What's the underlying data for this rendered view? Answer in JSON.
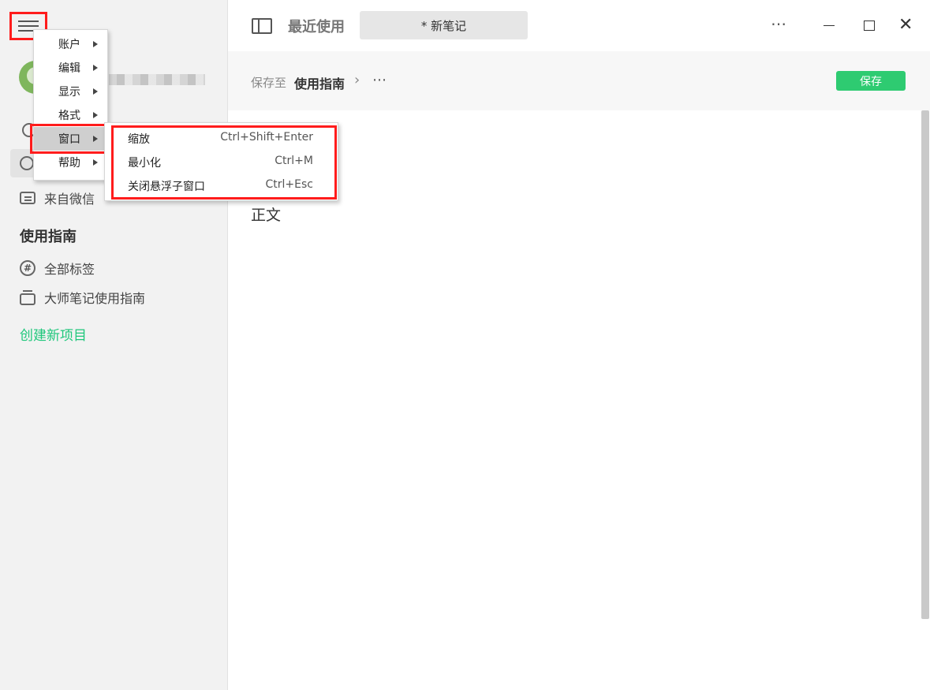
{
  "sidebar": {
    "recent_label": "最近使用",
    "wechat_label": "来自微信",
    "section_title": "使用指南",
    "all_tags_label": "全部标签",
    "guide_notebook_label": "大师笔记使用指南",
    "create_project_label": "创建新项目"
  },
  "topbar": {
    "title": "最近使用",
    "note_tab": "* 新笔记",
    "more_icon": "⋯",
    "close_icon": "✕"
  },
  "breadcrumb": {
    "save_to": "保存至",
    "target": "使用指南",
    "chevron": "›",
    "more": "⋯",
    "save_button": "保存"
  },
  "editor": {
    "body_text": "正文"
  },
  "menu": {
    "items": [
      {
        "label": "账户"
      },
      {
        "label": "编辑"
      },
      {
        "label": "显示"
      },
      {
        "label": "格式"
      },
      {
        "label": "窗口"
      },
      {
        "label": "帮助"
      }
    ],
    "highlighted": "窗口"
  },
  "submenu": {
    "items": [
      {
        "label": "缩放",
        "shortcut": "Ctrl+Shift+Enter"
      },
      {
        "label": "最小化",
        "shortcut": "Ctrl+M"
      },
      {
        "label": "关闭悬浮子窗口",
        "shortcut": "Ctrl+Esc"
      }
    ]
  },
  "colors": {
    "accent_green": "#2ecb71",
    "annotation_red": "#ff1c1c",
    "sidebar_bg": "#f2f2f2"
  }
}
